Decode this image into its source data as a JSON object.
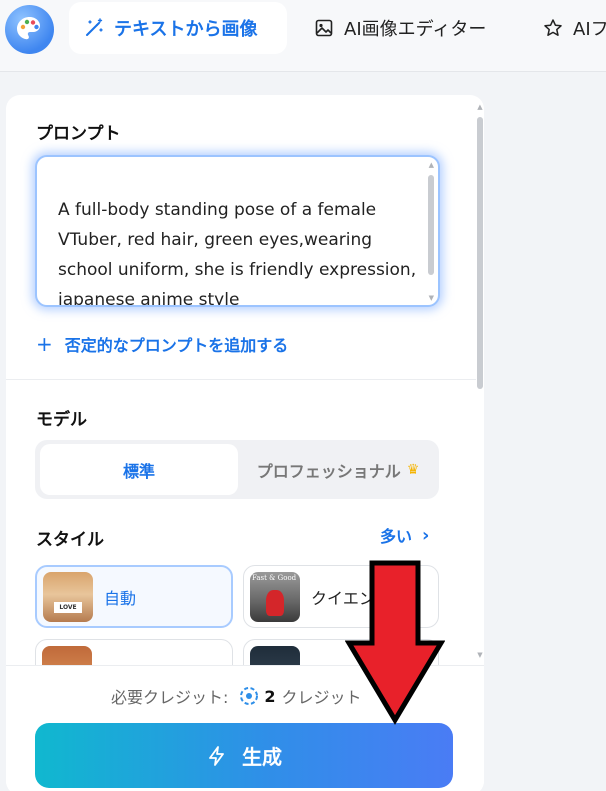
{
  "nav": {
    "tabs": [
      {
        "label": "テキストから画像",
        "icon": "magic-wand-icon",
        "active": true
      },
      {
        "label": "AI画像エディター",
        "icon": "image-icon",
        "active": false
      },
      {
        "label": "AIフ",
        "icon": "star-icon",
        "active": false
      }
    ]
  },
  "prompt": {
    "label": "プロンプト",
    "value": "A full-body standing pose of a female VTuber, red hair, green eyes,wearing school uniform, she is friendly expression, japanese anime style",
    "negative_link": "否定的なプロンプトを追加する"
  },
  "model": {
    "label": "モデル",
    "options": [
      "標準",
      "プロフェッショナル"
    ],
    "selected": "標準"
  },
  "style": {
    "label": "スタイル",
    "more_label": "多い",
    "cards": [
      {
        "label": "自動",
        "selected": true,
        "thumb_text": "LOVE"
      },
      {
        "label": "クイエン…",
        "selected": false,
        "thumb_text": "Fast & Good"
      },
      {
        "label": "",
        "selected": false
      },
      {
        "label": "",
        "selected": false
      }
    ]
  },
  "footer": {
    "credits_label": "必要クレジット:",
    "credits_value": "2",
    "credits_unit": "クレジット",
    "generate_label": "生成"
  },
  "colors": {
    "accent": "#1a73e8",
    "button_gradient_start": "#10b8cf",
    "button_gradient_end": "#4a7cf5",
    "annotation_arrow": "#e8212a"
  }
}
